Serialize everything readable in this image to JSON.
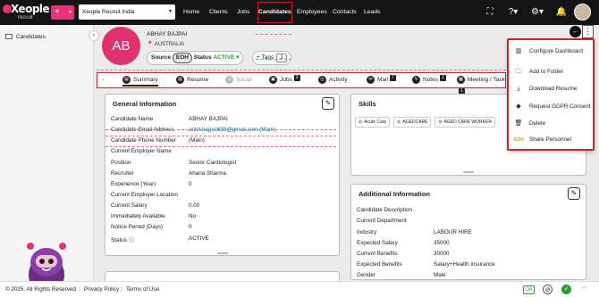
{
  "topbar": {
    "logo": {
      "brand": "Xeople",
      "sub": "recruit"
    },
    "add_label": "+",
    "tenant": "Xeople Recruit India",
    "nav": [
      "Home",
      "Clients",
      "Jobs",
      "Candidates",
      "Employees",
      "Contacts",
      "Leads"
    ],
    "active_nav": "Candidates",
    "icons": [
      "expand-icon",
      "help-icon",
      "settings-icon",
      "bell-icon",
      "user-avatar"
    ]
  },
  "sidebar": {
    "items": [
      {
        "label": "Candidates",
        "icon": "candidates-icon"
      }
    ]
  },
  "candidate": {
    "initials": "AB",
    "name": "ABHAY BAJPAI",
    "location": "AUSTRALIA",
    "source_label": "Source",
    "source_value": "EOH",
    "status_label": "Status",
    "status_value": "ACTIVE",
    "tags_label": "+ Tags",
    "tags_count": "1"
  },
  "tabs": [
    {
      "label": "Summary",
      "icon": "summary-icon",
      "badge": ""
    },
    {
      "label": "Resume",
      "icon": "resume-icon",
      "badge": ""
    },
    {
      "label": "Social",
      "icon": "social-icon",
      "badge": ""
    },
    {
      "label": "Jobs",
      "icon": "jobs-icon",
      "badge": "3"
    },
    {
      "label": "Activity",
      "icon": "activity-icon",
      "badge": ""
    },
    {
      "label": "Mail",
      "icon": "mail-icon",
      "badge": "7"
    },
    {
      "label": "Notes",
      "icon": "notes-icon",
      "badge": "1"
    },
    {
      "label": "Meeting / Task",
      "icon": "meeting-icon",
      "badge": "1"
    }
  ],
  "general": {
    "title": "General Information",
    "rows": [
      {
        "label": "Candidate Name",
        "value": "ABHAY BAJPAI"
      },
      {
        "label": "Candidate Email Address",
        "value": "ankit.bajpai658@gmail.com (Main)"
      },
      {
        "label": "Candidate Phone Number",
        "value": "(Main)"
      },
      {
        "label": "Current Employer Name",
        "value": ""
      },
      {
        "label": "Position",
        "value": "Senior Cardiologist"
      },
      {
        "label": "Recruiter",
        "value": "Ahana Sharma"
      },
      {
        "label": "Experience (Year)",
        "value": "0"
      },
      {
        "label": "Current Employer Location",
        "value": ""
      },
      {
        "label": "Current Salary",
        "value": "0.00"
      },
      {
        "label": "Immediately Available",
        "value": "No"
      },
      {
        "label": "Notice Period (Days)",
        "value": "0"
      },
      {
        "label": "Status",
        "value": "ACTIVE"
      }
    ]
  },
  "skills": {
    "title": "Skills",
    "tags": [
      "Acute Care",
      "AGEDCARE",
      "AGED CARE WORKER"
    ]
  },
  "additional": {
    "title": "Additional Information",
    "rows": [
      {
        "label": "Candidate Description",
        "value": ""
      },
      {
        "label": "Current Department",
        "value": ""
      },
      {
        "label": "Industry",
        "value": "LABOUR HIRE"
      },
      {
        "label": "Expected Salary",
        "value": "35000"
      },
      {
        "label": "Current Benefits",
        "value": "30000"
      },
      {
        "label": "Expected Benefits",
        "value": "Salary+Health insurance"
      },
      {
        "label": "Gender",
        "value": "Male"
      }
    ]
  },
  "menu": {
    "items": [
      {
        "label": "Configure Dashboard",
        "icon": "dashboard-icon"
      },
      {
        "label": "Add to Folder",
        "icon": "folder-icon"
      },
      {
        "label": "Download Resume",
        "icon": "download-icon"
      },
      {
        "label": "Request GDPR Consent",
        "icon": "gdpr-icon"
      },
      {
        "label": "Delete",
        "icon": "trash-icon"
      },
      {
        "label": "Share Personnel",
        "icon": "share-icon"
      }
    ]
  },
  "footer": {
    "copyright": "© 2025. All Rights Reserved",
    "privacy": "Privacy Policy",
    "terms": "Terms of Use",
    "qa": "QA"
  },
  "colors": {
    "brand": "#e8317a",
    "topbar": "#141414",
    "highlight": "#c62828",
    "active": "#2e9b2e"
  }
}
